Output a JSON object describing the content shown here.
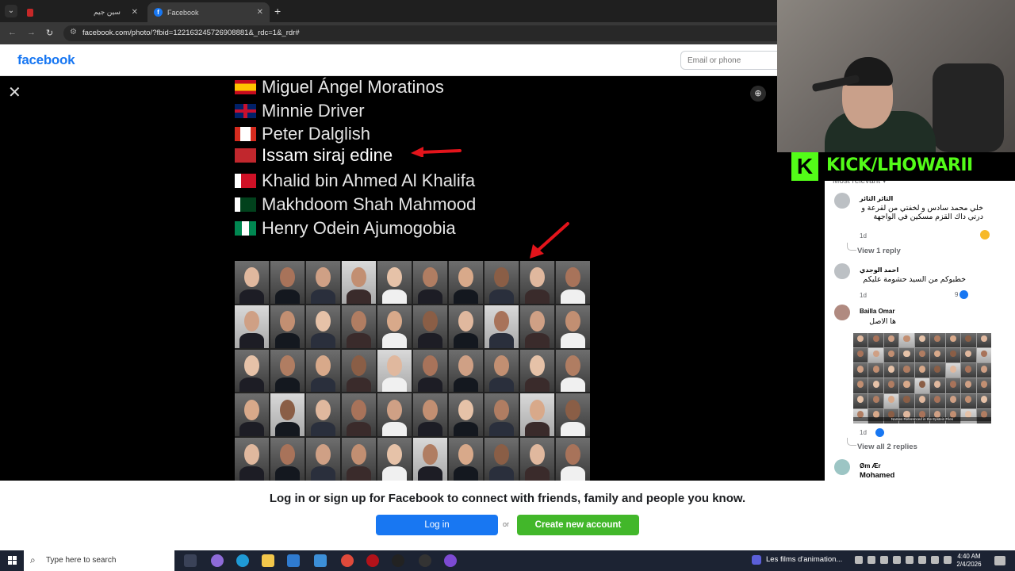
{
  "browser": {
    "tabs": [
      {
        "label": "سين جيم"
      },
      {
        "label": "Facebook"
      }
    ],
    "url": "facebook.com/photo/?fbid=122163245726908881&_rdc=1&_rdr#"
  },
  "fb_header": {
    "logo": "facebook",
    "email_placeholder": "Email or phone"
  },
  "photo": {
    "names": [
      {
        "flag": "es",
        "name": "Miguel Ángel Moratinos"
      },
      {
        "flag": "gb",
        "name": "Minnie Driver"
      },
      {
        "flag": "ca",
        "name": "Peter Dalglish"
      },
      {
        "flag": "ma",
        "name": "Issam siraj edine"
      },
      {
        "flag": "bh",
        "name": "Khalid bin Ahmed Al Khalifa"
      },
      {
        "flag": "pk",
        "name": "Makhdoom Shah Mahmood"
      },
      {
        "flag": "ng",
        "name": "Henry Odein Ajumogobia"
      }
    ]
  },
  "webcam": {
    "channel": "KICK/LHOWARII"
  },
  "comments": {
    "sort_label": "Most relevant ▾",
    "items": [
      {
        "author": "الثائر الثائر",
        "text": "خلي محمد سادس و لخفتي من لقرعة و درتي داك القزم مسكين في الواجهة",
        "age": "1d"
      },
      {
        "author": "احمد الوجدي",
        "text": "خطبوكم من السيد حشومة عليكم",
        "age": "1d",
        "likes": "9"
      },
      {
        "author": "Bailla Omar",
        "text": "ها الاصل",
        "age": "1d",
        "image_caption": "Names Referenced in the Epstein Files"
      },
      {
        "author": "Øm Ær",
        "text": "Mohamed"
      }
    ],
    "view_1_reply": "View 1 reply",
    "view_all_replies": "View all 2 replies"
  },
  "login_bar": {
    "message": "Log in or sign up for Facebook to connect with friends, family and people you know.",
    "login_label": "Log in",
    "or_label": "or",
    "create_label": "Create new account"
  },
  "taskbar": {
    "search_placeholder": "Type here to search",
    "notification": "Les films d'animation...",
    "time": "4:40 AM",
    "date": "2/4/2026"
  }
}
